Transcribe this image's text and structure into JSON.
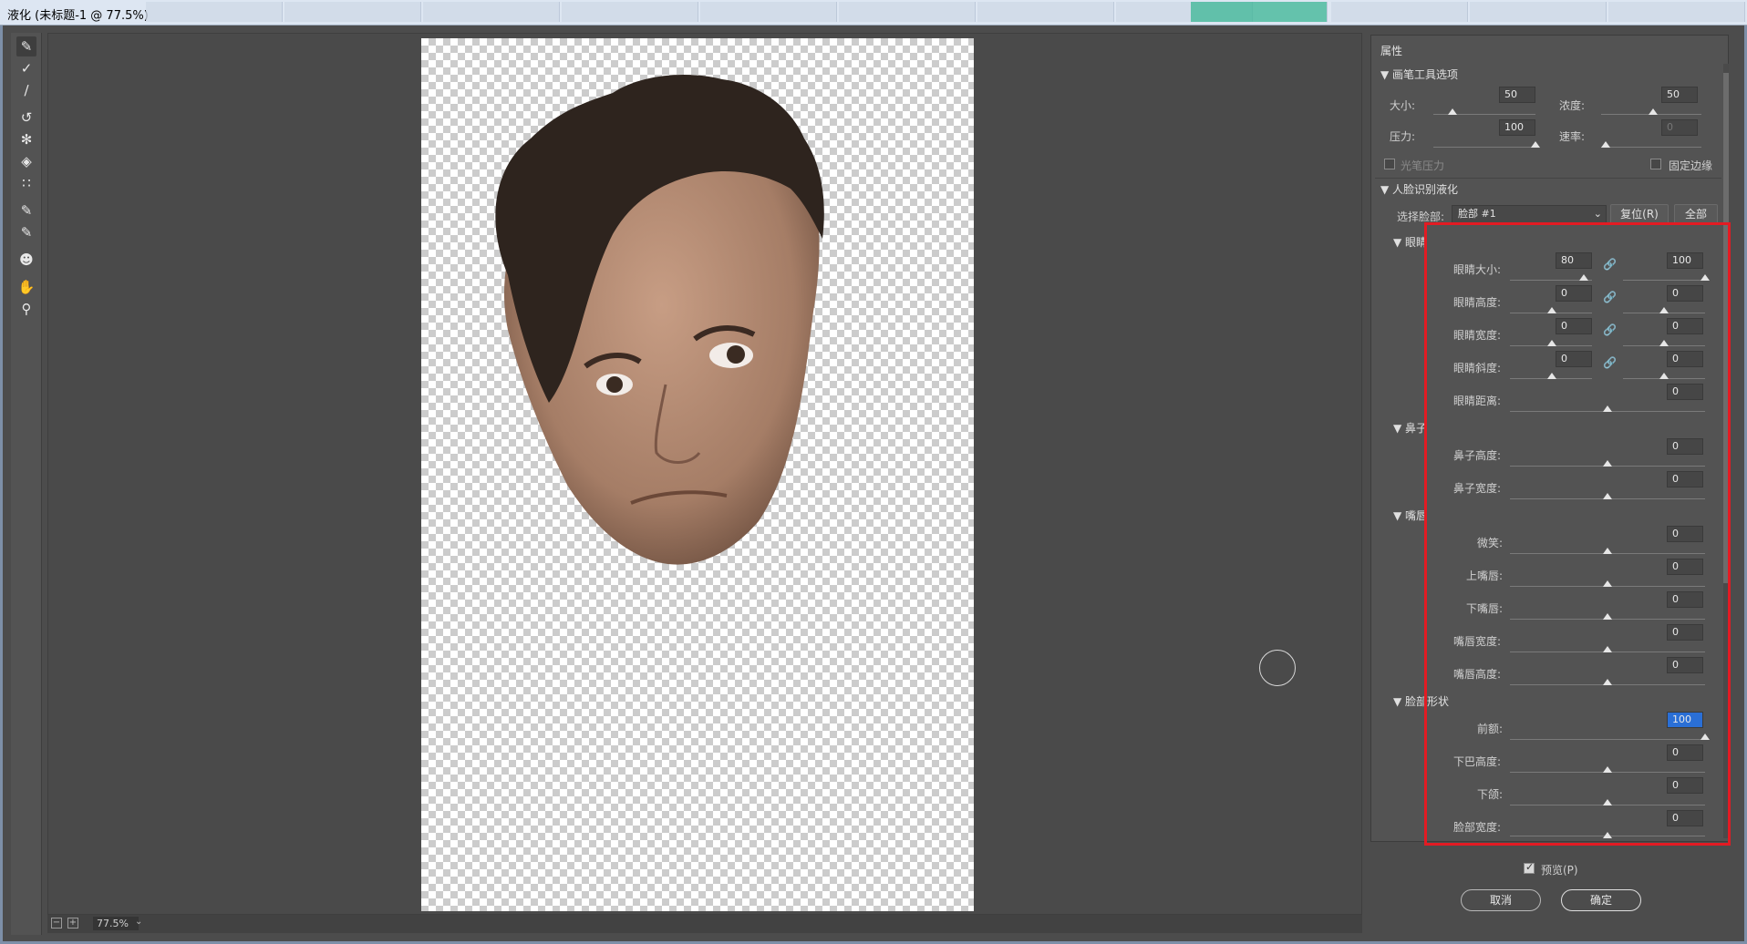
{
  "window": {
    "title": "液化 (未标题-1 @ 77.5%)"
  },
  "status": {
    "zoom": "77.5%"
  },
  "panel": {
    "title": "属性",
    "brush_section": "画笔工具选项",
    "size_label": "大小:",
    "size_value": "50",
    "density_label": "浓度:",
    "density_value": "50",
    "pressure_label": "压力:",
    "pressure_value": "100",
    "rate_label": "速率:",
    "rate_value": "0",
    "stylus_label": "光笔压力",
    "pin_edges_label": "固定边缘",
    "face_section": "人脸识别液化",
    "select_face_label": "选择脸部:",
    "select_face_value": "脸部 #1",
    "reset_label": "复位(R)",
    "all_label": "全部",
    "eyes_section": "眼睛",
    "eye_size": {
      "label": "眼睛大小:",
      "left": "80",
      "right": "100"
    },
    "eye_height": {
      "label": "眼睛高度:",
      "left": "0",
      "right": "0"
    },
    "eye_width": {
      "label": "眼睛宽度:",
      "left": "0",
      "right": "0"
    },
    "eye_tilt": {
      "label": "眼睛斜度:",
      "left": "0",
      "right": "0"
    },
    "eye_distance": {
      "label": "眼睛距离:",
      "value": "0"
    },
    "nose_section": "鼻子",
    "nose_height": {
      "label": "鼻子高度:",
      "value": "0"
    },
    "nose_width": {
      "label": "鼻子宽度:",
      "value": "0"
    },
    "mouth_section": "嘴唇",
    "smile": {
      "label": "微笑:",
      "value": "0"
    },
    "upper_lip": {
      "label": "上嘴唇:",
      "value": "0"
    },
    "lower_lip": {
      "label": "下嘴唇:",
      "value": "0"
    },
    "mouth_width": {
      "label": "嘴唇宽度:",
      "value": "0"
    },
    "mouth_height": {
      "label": "嘴唇高度:",
      "value": "0"
    },
    "face_shape_section": "脸部形状",
    "forehead": {
      "label": "前额:",
      "value": "100"
    },
    "chin_height": {
      "label": "下巴高度:",
      "value": "0"
    },
    "jawline": {
      "label": "下颌:",
      "value": "0"
    },
    "face_width": {
      "label": "脸部宽度:",
      "value": "0"
    }
  },
  "footer": {
    "preview_label": "预览(P)",
    "cancel_label": "取消",
    "ok_label": "确定"
  },
  "colors": {
    "highlight": "#e31b23",
    "panel_bg": "#535353",
    "canvas_bg": "#4a4a4a"
  }
}
